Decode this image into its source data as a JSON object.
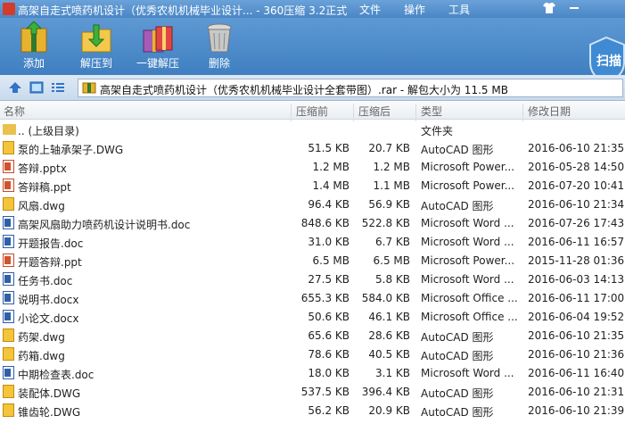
{
  "window": {
    "title": "高架自走式喷药机设计（优秀农机机械毕业设计... - 360压缩 3.2正式",
    "menus": [
      "文件",
      "操作",
      "工具"
    ]
  },
  "toolbar": {
    "add": "添加",
    "extract_to": "解压到",
    "one_click_extract": "一键解压",
    "delete": "删除",
    "scan": "扫描"
  },
  "address": {
    "path": "高架自走式喷药机设计（优秀农机机械毕业设计全套带图）.rar - 解包大小为 11.5 MB"
  },
  "columns": {
    "name": "名称",
    "size": "压缩前",
    "packed": "压缩后",
    "type": "类型",
    "date": "修改日期"
  },
  "rows": [
    {
      "icon": "folder",
      "name": ".. (上级目录)",
      "size": "",
      "packed": "",
      "type": "文件夹",
      "date": ""
    },
    {
      "icon": "dwg",
      "name": "泵的上轴承架子.DWG",
      "size": "51.5 KB",
      "packed": "20.7 KB",
      "type": "AutoCAD 图形",
      "date": "2016-06-10 21:35"
    },
    {
      "icon": "ppt",
      "name": "答辩.pptx",
      "size": "1.2 MB",
      "packed": "1.2 MB",
      "type": "Microsoft Power...",
      "date": "2016-05-28 14:50"
    },
    {
      "icon": "ppt",
      "name": "答辩稿.ppt",
      "size": "1.4 MB",
      "packed": "1.1 MB",
      "type": "Microsoft Power...",
      "date": "2016-07-20 10:41"
    },
    {
      "icon": "dwg",
      "name": "风扇.dwg",
      "size": "96.4 KB",
      "packed": "56.9 KB",
      "type": "AutoCAD 图形",
      "date": "2016-06-10 21:34"
    },
    {
      "icon": "doc",
      "name": "高架风扇助力喷药机设计说明书.doc",
      "size": "848.6 KB",
      "packed": "522.8 KB",
      "type": "Microsoft Word ...",
      "date": "2016-07-26 17:43"
    },
    {
      "icon": "doc",
      "name": "开题报告.doc",
      "size": "31.0 KB",
      "packed": "6.7 KB",
      "type": "Microsoft Word ...",
      "date": "2016-06-11 16:57"
    },
    {
      "icon": "ppt",
      "name": "开题答辩.ppt",
      "size": "6.5 MB",
      "packed": "6.5 MB",
      "type": "Microsoft Power...",
      "date": "2015-11-28 01:36"
    },
    {
      "icon": "doc",
      "name": "任务书.doc",
      "size": "27.5 KB",
      "packed": "5.8 KB",
      "type": "Microsoft Word ...",
      "date": "2016-06-03 14:13"
    },
    {
      "icon": "doc",
      "name": "说明书.docx",
      "size": "655.3 KB",
      "packed": "584.0 KB",
      "type": "Microsoft Office ...",
      "date": "2016-06-11 17:00"
    },
    {
      "icon": "doc",
      "name": "小论文.docx",
      "size": "50.6 KB",
      "packed": "46.1 KB",
      "type": "Microsoft Office ...",
      "date": "2016-06-04 19:52"
    },
    {
      "icon": "dwg",
      "name": "药架.dwg",
      "size": "65.6 KB",
      "packed": "28.6 KB",
      "type": "AutoCAD 图形",
      "date": "2016-06-10 21:35"
    },
    {
      "icon": "dwg",
      "name": "药箱.dwg",
      "size": "78.6 KB",
      "packed": "40.5 KB",
      "type": "AutoCAD 图形",
      "date": "2016-06-10 21:36"
    },
    {
      "icon": "doc",
      "name": "中期检查表.doc",
      "size": "18.0 KB",
      "packed": "3.1 KB",
      "type": "Microsoft Word ...",
      "date": "2016-06-11 16:40"
    },
    {
      "icon": "dwg",
      "name": "装配体.DWG",
      "size": "537.5 KB",
      "packed": "396.4 KB",
      "type": "AutoCAD 图形",
      "date": "2016-06-10 21:31"
    },
    {
      "icon": "dwg",
      "name": "锥齿轮.DWG",
      "size": "56.2 KB",
      "packed": "20.9 KB",
      "type": "AutoCAD 图形",
      "date": "2016-06-10 21:39"
    }
  ]
}
